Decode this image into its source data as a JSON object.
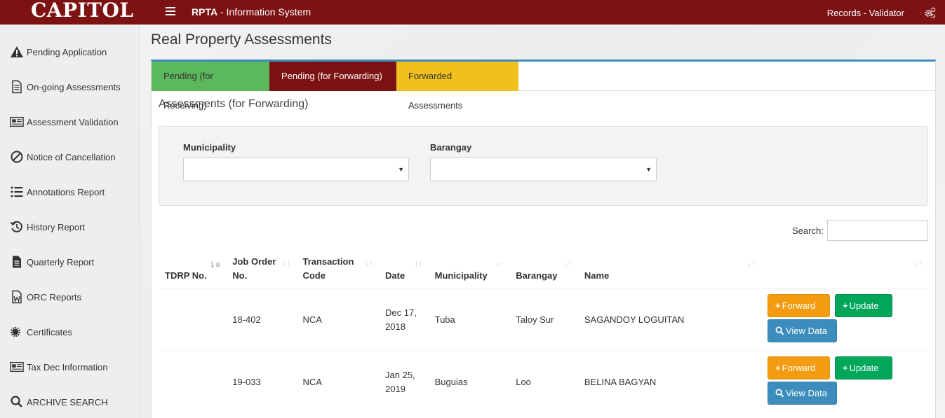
{
  "header": {
    "logo": "CAPITOL",
    "app_short": "RPTA",
    "app_title": " - Information System",
    "user_role": "Records - Validator",
    "colors": {
      "topbar": "#7d1212"
    }
  },
  "sidebar": {
    "items": [
      {
        "label": "Pending Application",
        "icon": "warning-icon"
      },
      {
        "label": "On-going Assessments",
        "icon": "document-icon"
      },
      {
        "label": "Assessment Validation",
        "icon": "newspaper-icon"
      },
      {
        "label": "Notice of Cancellation",
        "icon": "ban-icon"
      },
      {
        "label": "Annotations Report",
        "icon": "list-icon"
      },
      {
        "label": "History Report",
        "icon": "history-icon"
      },
      {
        "label": "Quarterly Report",
        "icon": "file-icon"
      },
      {
        "label": "ORC Reports",
        "icon": "word-file-icon"
      },
      {
        "label": "Certificates",
        "icon": "certificate-icon"
      },
      {
        "label": "Tax Dec Information",
        "icon": "newspaper-icon"
      },
      {
        "label": "ARCHIVE SEARCH",
        "icon": "search-icon"
      }
    ]
  },
  "main": {
    "page_title": "Real Property Assessments",
    "tabs": [
      {
        "label": "Pending (for Receiving)",
        "color": "#5cb85c"
      },
      {
        "label": "Pending (for Forwarding)",
        "color": "#7d1212"
      },
      {
        "label": "Forwarded Assessments",
        "color": "#f0c01e"
      }
    ],
    "section_title": "Assessments (for Forwarding)",
    "filters": {
      "municipality_label": "Municipality",
      "municipality_value": "",
      "barangay_label": "Barangay",
      "barangay_value": ""
    },
    "search": {
      "label": "Search:",
      "value": ""
    },
    "table": {
      "headers": {
        "tdrp": "TDRP No.",
        "job_order_1": "Job Order",
        "job_order_2": "No.",
        "transaction_1": "Transaction",
        "transaction_2": "Code",
        "date": "Date",
        "municipality": "Municipality",
        "barangay": "Barangay",
        "name": "Name"
      },
      "rows": [
        {
          "tdrp": "",
          "job_order": "18-402",
          "transaction": "NCA",
          "date_1": "Dec 17,",
          "date_2": "2018",
          "municipality": "Tuba",
          "barangay": "Taloy Sur",
          "name": "SAGANDOY LOGUITAN"
        },
        {
          "tdrp": "",
          "job_order": "19-033",
          "transaction": "NCA",
          "date_1": "Jan 25,",
          "date_2": "2019",
          "municipality": "Buguias",
          "barangay": "Loo",
          "name": "BELINA BAGYAN"
        }
      ],
      "buttons": {
        "forward": "Forward",
        "update": "Update",
        "view": "View Data"
      }
    }
  }
}
